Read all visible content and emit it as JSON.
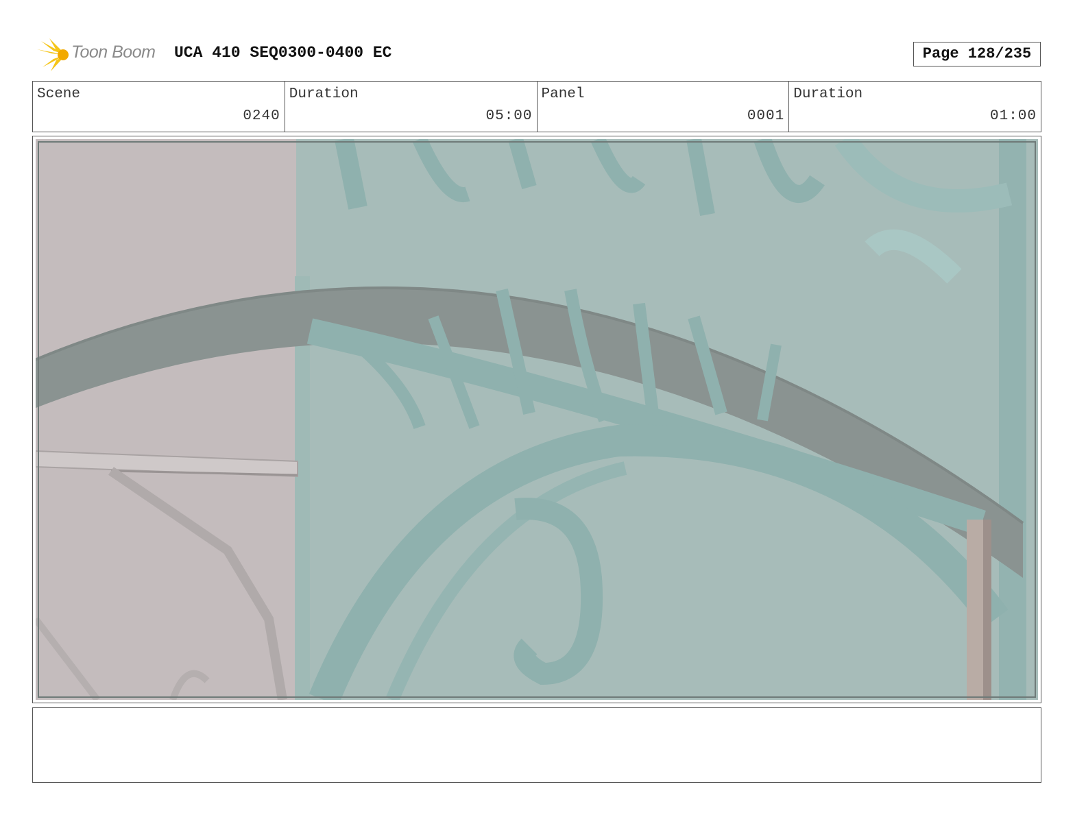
{
  "header": {
    "logo_text": "Toon Boom",
    "title": "UCA 410 SEQ0300-0400 EC",
    "page": "Page 128/235"
  },
  "info": [
    {
      "label": "Scene",
      "value": "0240"
    },
    {
      "label": "Duration",
      "value": "05:00"
    },
    {
      "label": "Panel",
      "value": "0001"
    },
    {
      "label": "Duration",
      "value": "01:00"
    }
  ],
  "colors": {
    "logo_yellow": "#f5c518",
    "wall": "#c4bcbd",
    "iron": "#8fb1ae",
    "iron_dark": "#8a9391",
    "background_teal": "#a7bcb9"
  },
  "notes": ""
}
